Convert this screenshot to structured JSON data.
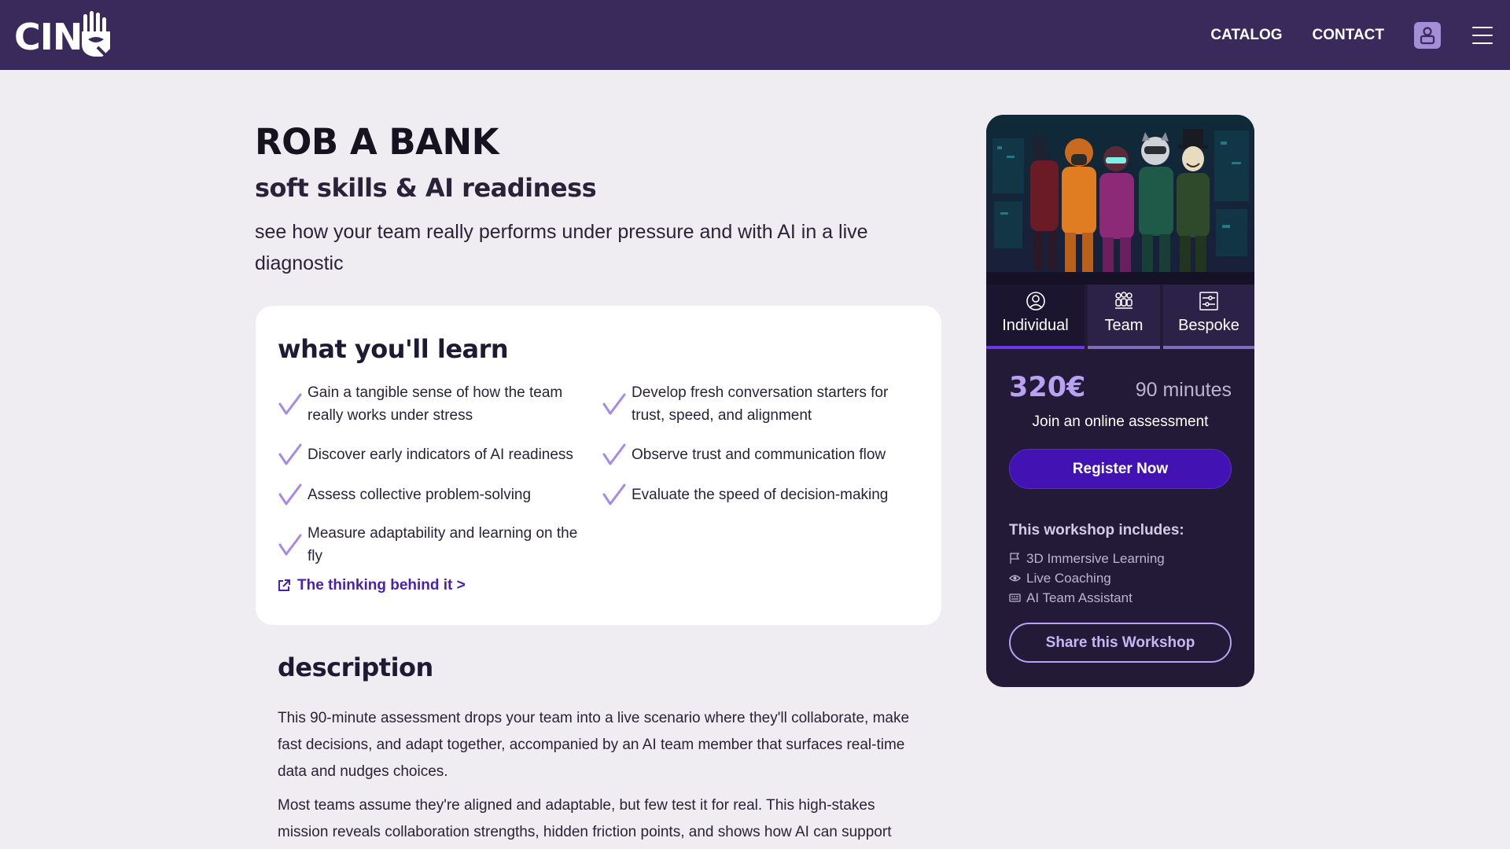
{
  "header": {
    "logo_text": "CIN",
    "nav": {
      "catalog_label": "CATALOG",
      "contact_label": "CONTACT"
    },
    "icons": [
      "hand-logo-icon",
      "user-icon",
      "hamburger-menu-icon"
    ]
  },
  "hero": {
    "title": "ROB A BANK",
    "subtitle": "soft skills & AI readiness",
    "tagline": "see how your team really performs under pressure and with AI in a live diagnostic"
  },
  "learn": {
    "heading": "what you'll learn",
    "left_items": [
      "Gain a tangible sense of how the team really works under stress",
      "Discover early indicators of AI readiness",
      "Assess collective problem-solving",
      "Measure adaptability and learning on the fly"
    ],
    "right_items": [
      "Develop fresh conversation starters for trust, speed, and alignment",
      "Observe trust and communication flow",
      "Evaluate the speed of decision-making"
    ],
    "link_label": "The thinking behind it >"
  },
  "description": {
    "heading": "description",
    "p1": "This 90-minute assessment drops your team into a live scenario where they'll collaborate, make fast decisions, and adapt together, accompanied by an AI team member that surfaces real-time data and nudges choices.",
    "p2": "Most teams assume they're aligned and adaptable, but few test it for real. This high-stakes mission reveals collaboration strengths, hidden friction points, and shows how AI can support"
  },
  "booking": {
    "tabs": [
      {
        "label": "Individual",
        "icon": "person-icon",
        "active": true
      },
      {
        "label": "Team",
        "icon": "team-icon",
        "active": false
      },
      {
        "label": "Bespoke",
        "icon": "settings-card-icon",
        "active": false
      }
    ],
    "price": "320€",
    "duration": "90 minutes",
    "join_text": "Join an online assessment",
    "register_label": "Register Now",
    "includes_title": "This workshop includes:",
    "includes": [
      {
        "label": "3D Immersive Learning",
        "icon": "flag-icon"
      },
      {
        "label": "Live Coaching",
        "icon": "eye-icon"
      },
      {
        "label": "AI Team Assistant",
        "icon": "keyboard-icon"
      }
    ],
    "share_label": "Share this Workshop"
  },
  "colors": {
    "header_bg": "#3a2a5c",
    "page_bg": "#efedf1",
    "accent": "#4212b3",
    "check": "#a58ae6",
    "card_dark": "#221a36"
  }
}
